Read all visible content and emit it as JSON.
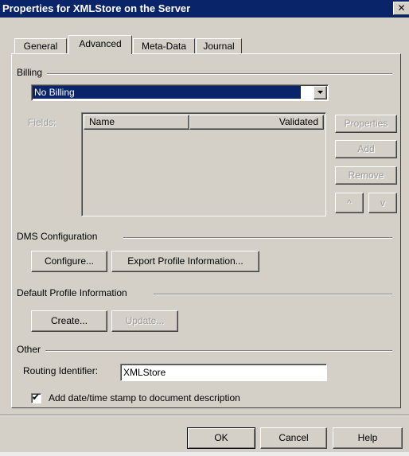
{
  "window": {
    "title": "Properties for XMLStore on the Server",
    "close_glyph": "✕"
  },
  "tabs": [
    {
      "label": "General",
      "active": false
    },
    {
      "label": "Advanced",
      "active": true
    },
    {
      "label": "Meta-Data",
      "active": false
    },
    {
      "label": "Journal",
      "active": false
    }
  ],
  "billing": {
    "group_label": "Billing",
    "dropdown_value": "No Billing",
    "fields_label": "Fields:",
    "columns": [
      "Name",
      "Validated"
    ],
    "rows": [],
    "buttons": {
      "properties": "Properties",
      "add": "Add",
      "remove": "Remove",
      "up": "^",
      "down": "v"
    }
  },
  "dms": {
    "group_label": "DMS Configuration",
    "configure": "Configure...",
    "export": "Export Profile Information..."
  },
  "default_profile": {
    "group_label": "Default Profile Information",
    "create": "Create...",
    "update": "Update..."
  },
  "other": {
    "group_label": "Other",
    "routing_label": "Routing Identifier:",
    "routing_value": "XMLStore",
    "checkbox_label": "Add date/time stamp to document description",
    "checkbox_checked": true,
    "check_glyph": "✔"
  },
  "footer": {
    "ok": "OK",
    "cancel": "Cancel",
    "help": "Help"
  }
}
